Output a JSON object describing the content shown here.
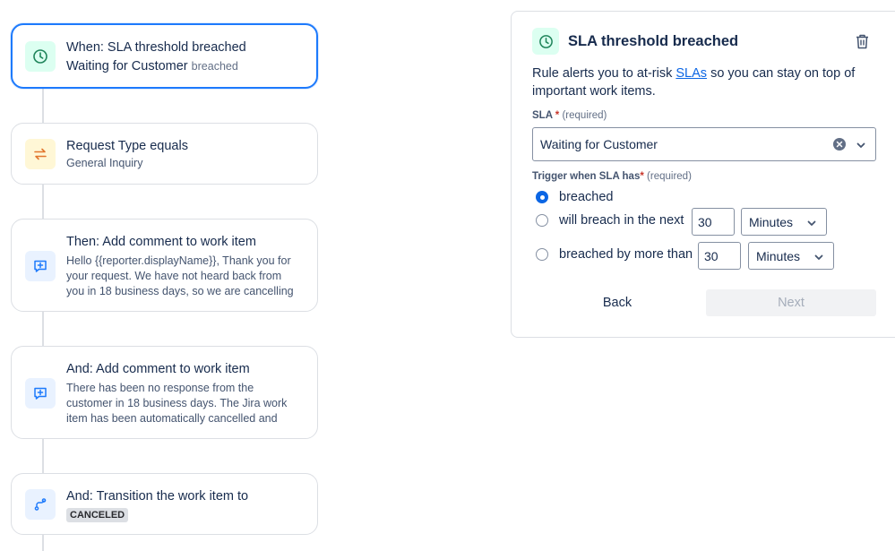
{
  "flow": {
    "trigger": {
      "title": "When: SLA threshold breached",
      "value": "Waiting for Customer",
      "qualifier": "breached"
    },
    "condition": {
      "title": "Request Type equals",
      "value": "General Inquiry"
    },
    "action1": {
      "title": "Then: Add comment to work item",
      "lines": [
        "Hello {{reporter.displayName}}, Thank you for",
        "your request. We have not heard back from",
        "you in 18 business days, so we are cancelling"
      ]
    },
    "action2": {
      "title": "And: Add comment to work item",
      "lines": [
        "There has been no response from the",
        "customer in 18 business days. The Jira work",
        "item has been automatically cancelled and"
      ]
    },
    "action3": {
      "title": "And: Transition the work item to",
      "status": "CANCELED"
    }
  },
  "panel": {
    "title": "SLA threshold breached",
    "desc_before": "Rule alerts you to at-risk ",
    "desc_link": "SLAs",
    "desc_after": " so you can stay on top of important work items.",
    "sla_label": "SLA",
    "required_mark": "*",
    "required_text": "(required)",
    "sla_value": "Waiting for Customer",
    "trigger_label": "Trigger when SLA has",
    "options": [
      {
        "label": "breached",
        "checked": true
      },
      {
        "label": "will breach in the next",
        "value": "30",
        "unit": "Minutes",
        "checked": false
      },
      {
        "label": "breached by more than",
        "value": "30",
        "unit": "Minutes",
        "checked": false
      }
    ],
    "back_label": "Back",
    "next_label": "Next"
  },
  "icons": {
    "trigger": "clock-icon",
    "condition": "swap-arrows-icon",
    "comment": "comment-add-icon",
    "transition": "transition-icon",
    "delete": "trash-icon"
  },
  "colors": {
    "accent": "#0c66e4",
    "selected_border": "#1d7afc",
    "required": "#c9372c"
  }
}
